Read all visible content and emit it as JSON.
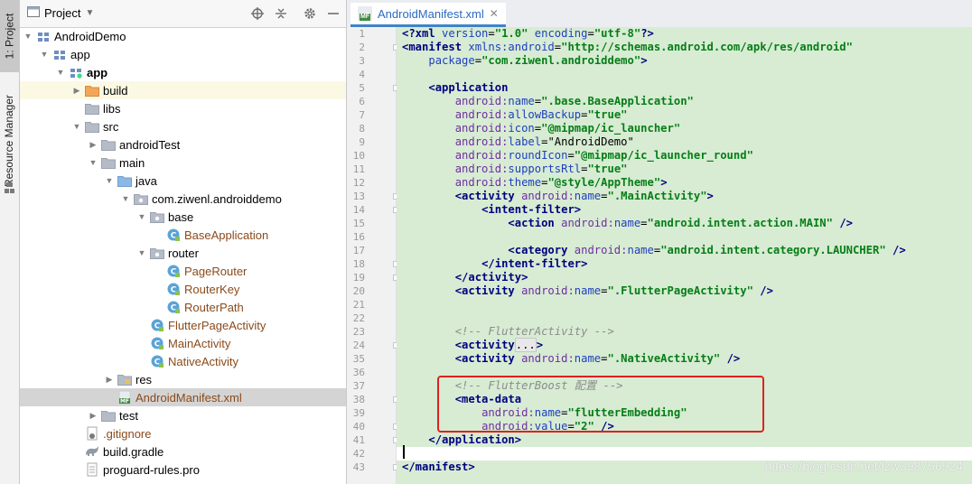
{
  "side_tabs": {
    "project": "1: Project",
    "resource_manager": "Resource Manager"
  },
  "project_panel": {
    "title": "Project",
    "toolbar_icons": [
      "crosshair-icon",
      "collapse-icon",
      "gear-icon",
      "hide-icon"
    ]
  },
  "tree": [
    {
      "depth": 0,
      "label": "AndroidDemo",
      "icon": "module-icon",
      "expanded": true
    },
    {
      "depth": 1,
      "label": "app",
      "icon": "module-icon",
      "expanded": true
    },
    {
      "depth": 2,
      "label": "app",
      "icon": "android-module-icon",
      "expanded": true,
      "bold": true
    },
    {
      "depth": 3,
      "label": "build",
      "icon": "orange-folder-icon",
      "expanded": false
    },
    {
      "depth": 3,
      "label": "libs",
      "icon": "folder-icon",
      "expanded": null
    },
    {
      "depth": 3,
      "label": "src",
      "icon": "folder-icon",
      "expanded": true
    },
    {
      "depth": 4,
      "label": "androidTest",
      "icon": "folder-icon",
      "expanded": false
    },
    {
      "depth": 4,
      "label": "main",
      "icon": "folder-icon",
      "expanded": true
    },
    {
      "depth": 5,
      "label": "java",
      "icon": "blue-folder-icon",
      "expanded": true
    },
    {
      "depth": 6,
      "label": "com.ziwenl.androiddemo",
      "icon": "package-icon",
      "expanded": true
    },
    {
      "depth": 7,
      "label": "base",
      "icon": "package-icon",
      "expanded": true
    },
    {
      "depth": 8,
      "label": "BaseApplication",
      "icon": "class-icon",
      "expanded": null,
      "cls": true
    },
    {
      "depth": 7,
      "label": "router",
      "icon": "package-icon",
      "expanded": true
    },
    {
      "depth": 8,
      "label": "PageRouter",
      "icon": "class-icon",
      "expanded": null,
      "cls": true
    },
    {
      "depth": 8,
      "label": "RouterKey",
      "icon": "class-icon",
      "expanded": null,
      "cls": true
    },
    {
      "depth": 8,
      "label": "RouterPath",
      "icon": "class-icon",
      "expanded": null,
      "cls": true
    },
    {
      "depth": 7,
      "label": "FlutterPageActivity",
      "icon": "class-icon",
      "expanded": null,
      "cls": true
    },
    {
      "depth": 7,
      "label": "MainActivity",
      "icon": "class-icon",
      "expanded": null,
      "cls": true
    },
    {
      "depth": 7,
      "label": "NativeActivity",
      "icon": "class-icon",
      "expanded": null,
      "cls": true
    },
    {
      "depth": 5,
      "label": "res",
      "icon": "res-folder-icon",
      "expanded": false
    },
    {
      "depth": 5,
      "label": "AndroidManifest.xml",
      "icon": "manifest-icon",
      "expanded": null,
      "cls": true,
      "selected": true
    },
    {
      "depth": 4,
      "label": "test",
      "icon": "folder-icon",
      "expanded": false
    },
    {
      "depth": 3,
      "label": ".gitignore",
      "icon": "gitignore-icon",
      "expanded": null,
      "cls": true
    },
    {
      "depth": 3,
      "label": "build.gradle",
      "icon": "gradle-icon",
      "expanded": null
    },
    {
      "depth": 3,
      "label": "proguard-rules.pro",
      "icon": "file-icon",
      "expanded": null
    }
  ],
  "editor": {
    "tab_label": "AndroidManifest.xml",
    "tab_badge": "MF",
    "lines": [
      {
        "n": "1",
        "parts": [
          [
            "tag",
            "<?xml "
          ],
          [
            "an",
            "version"
          ],
          [
            "pl",
            "="
          ],
          [
            "sv",
            "\"1.0\""
          ],
          [
            "pl",
            " "
          ],
          [
            "an",
            "encoding"
          ],
          [
            "pl",
            "="
          ],
          [
            "sv",
            "\"utf-8\""
          ],
          [
            "tag",
            "?>"
          ]
        ]
      },
      {
        "n": "2",
        "parts": [
          [
            "tag",
            "<manifest "
          ],
          [
            "an",
            "xmlns:android"
          ],
          [
            "pl",
            "="
          ],
          [
            "sv",
            "\"http://schemas.android.com/apk/res/android\""
          ]
        ]
      },
      {
        "n": "3",
        "parts": [
          [
            "pl",
            "    "
          ],
          [
            "an",
            "package"
          ],
          [
            "pl",
            "="
          ],
          [
            "sv",
            "\"com.ziwenl.androiddemo\""
          ],
          [
            "tag",
            ">"
          ]
        ]
      },
      {
        "n": "4",
        "parts": []
      },
      {
        "n": "5",
        "parts": [
          [
            "pl",
            "    "
          ],
          [
            "tag",
            "<application"
          ]
        ]
      },
      {
        "n": "6",
        "parts": [
          [
            "pl",
            "        "
          ],
          [
            "ns",
            "android:"
          ],
          [
            "an",
            "name"
          ],
          [
            "pl",
            "="
          ],
          [
            "sv",
            "\".base.BaseApplication\""
          ]
        ]
      },
      {
        "n": "7",
        "parts": [
          [
            "pl",
            "        "
          ],
          [
            "ns",
            "android:"
          ],
          [
            "an",
            "allowBackup"
          ],
          [
            "pl",
            "="
          ],
          [
            "sv",
            "\"true\""
          ]
        ]
      },
      {
        "n": "8",
        "parts": [
          [
            "pl",
            "        "
          ],
          [
            "ns",
            "android:"
          ],
          [
            "an",
            "icon"
          ],
          [
            "pl",
            "="
          ],
          [
            "sv",
            "\"@mipmap/ic_launcher\""
          ]
        ]
      },
      {
        "n": "9",
        "parts": [
          [
            "pl",
            "        "
          ],
          [
            "ns",
            "android:"
          ],
          [
            "an",
            "label"
          ],
          [
            "pl",
            "="
          ],
          [
            "pl",
            "\"AndroidDemo\""
          ]
        ]
      },
      {
        "n": "10",
        "parts": [
          [
            "pl",
            "        "
          ],
          [
            "ns",
            "android:"
          ],
          [
            "an",
            "roundIcon"
          ],
          [
            "pl",
            "="
          ],
          [
            "sv",
            "\"@mipmap/ic_launcher_round\""
          ]
        ]
      },
      {
        "n": "11",
        "parts": [
          [
            "pl",
            "        "
          ],
          [
            "ns",
            "android:"
          ],
          [
            "an",
            "supportsRtl"
          ],
          [
            "pl",
            "="
          ],
          [
            "sv",
            "\"true\""
          ]
        ]
      },
      {
        "n": "12",
        "parts": [
          [
            "pl",
            "        "
          ],
          [
            "ns",
            "android:"
          ],
          [
            "an",
            "theme"
          ],
          [
            "pl",
            "="
          ],
          [
            "sv",
            "\"@style/AppTheme\""
          ],
          [
            "tag",
            ">"
          ]
        ]
      },
      {
        "n": "13",
        "parts": [
          [
            "pl",
            "        "
          ],
          [
            "tag",
            "<activity "
          ],
          [
            "ns",
            "android:"
          ],
          [
            "an",
            "name"
          ],
          [
            "pl",
            "="
          ],
          [
            "sv",
            "\".MainActivity\""
          ],
          [
            "tag",
            ">"
          ]
        ]
      },
      {
        "n": "14",
        "parts": [
          [
            "pl",
            "            "
          ],
          [
            "tag",
            "<intent-filter>"
          ]
        ]
      },
      {
        "n": "15",
        "parts": [
          [
            "pl",
            "                "
          ],
          [
            "tag",
            "<action "
          ],
          [
            "ns",
            "android:"
          ],
          [
            "an",
            "name"
          ],
          [
            "pl",
            "="
          ],
          [
            "sv",
            "\"android.intent.action.MAIN\""
          ],
          [
            "pl",
            " "
          ],
          [
            "tag",
            "/>"
          ]
        ]
      },
      {
        "n": "16",
        "parts": []
      },
      {
        "n": "17",
        "parts": [
          [
            "pl",
            "                "
          ],
          [
            "tag",
            "<category "
          ],
          [
            "ns",
            "android:"
          ],
          [
            "an",
            "name"
          ],
          [
            "pl",
            "="
          ],
          [
            "sv",
            "\"android.intent.category.LAUNCHER\""
          ],
          [
            "pl",
            " "
          ],
          [
            "tag",
            "/>"
          ]
        ]
      },
      {
        "n": "18",
        "parts": [
          [
            "pl",
            "            "
          ],
          [
            "tag",
            "</intent-filter>"
          ]
        ]
      },
      {
        "n": "19",
        "parts": [
          [
            "pl",
            "        "
          ],
          [
            "tag",
            "</activity>"
          ]
        ]
      },
      {
        "n": "20",
        "parts": [
          [
            "pl",
            "        "
          ],
          [
            "tag",
            "<activity "
          ],
          [
            "ns",
            "android:"
          ],
          [
            "an",
            "name"
          ],
          [
            "pl",
            "="
          ],
          [
            "sv",
            "\".FlutterPageActivity\""
          ],
          [
            "pl",
            " "
          ],
          [
            "tag",
            "/>"
          ]
        ]
      },
      {
        "n": "21",
        "parts": []
      },
      {
        "n": "22",
        "parts": []
      },
      {
        "n": "23",
        "parts": [
          [
            "pl",
            "        "
          ],
          [
            "cm",
            "<!-- FlutterActivity -->"
          ]
        ]
      },
      {
        "n": "24",
        "parts": [
          [
            "pl",
            "        "
          ],
          [
            "tag",
            "<activity"
          ],
          [
            "ph",
            "..."
          ],
          [
            "tag",
            ">"
          ]
        ]
      },
      {
        "n": "35",
        "parts": [
          [
            "pl",
            "        "
          ],
          [
            "tag",
            "<activity "
          ],
          [
            "ns",
            "android:"
          ],
          [
            "an",
            "name"
          ],
          [
            "pl",
            "="
          ],
          [
            "sv",
            "\".NativeActivity\""
          ],
          [
            "pl",
            " "
          ],
          [
            "tag",
            "/>"
          ]
        ]
      },
      {
        "n": "36",
        "parts": []
      },
      {
        "n": "37",
        "parts": [
          [
            "pl",
            "        "
          ],
          [
            "cm",
            "<!-- FlutterBoost 配置 -->"
          ]
        ]
      },
      {
        "n": "38",
        "parts": [
          [
            "pl",
            "        "
          ],
          [
            "tag",
            "<meta-data"
          ]
        ]
      },
      {
        "n": "39",
        "parts": [
          [
            "pl",
            "            "
          ],
          [
            "ns",
            "android:"
          ],
          [
            "an",
            "name"
          ],
          [
            "pl",
            "="
          ],
          [
            "sv",
            "\"flutterEmbedding\""
          ]
        ]
      },
      {
        "n": "40",
        "parts": [
          [
            "pl",
            "            "
          ],
          [
            "ns",
            "android:"
          ],
          [
            "an",
            "value"
          ],
          [
            "pl",
            "="
          ],
          [
            "sv",
            "\"2\""
          ],
          [
            "pl",
            " "
          ],
          [
            "tag",
            "/>"
          ]
        ]
      },
      {
        "n": "41",
        "parts": [
          [
            "pl",
            "    "
          ],
          [
            "tag",
            "</application>"
          ]
        ]
      },
      {
        "n": "42",
        "parts": [],
        "current": true
      },
      {
        "n": "43",
        "parts": [
          [
            "tag",
            "</manifest>"
          ]
        ]
      }
    ]
  },
  "watermark": "https://blog.csdn.net/lzw398756924",
  "colors": {
    "code_bg": "#d7ecd3",
    "highlight_box": "#e02020",
    "tab_accent": "#4083c9"
  }
}
